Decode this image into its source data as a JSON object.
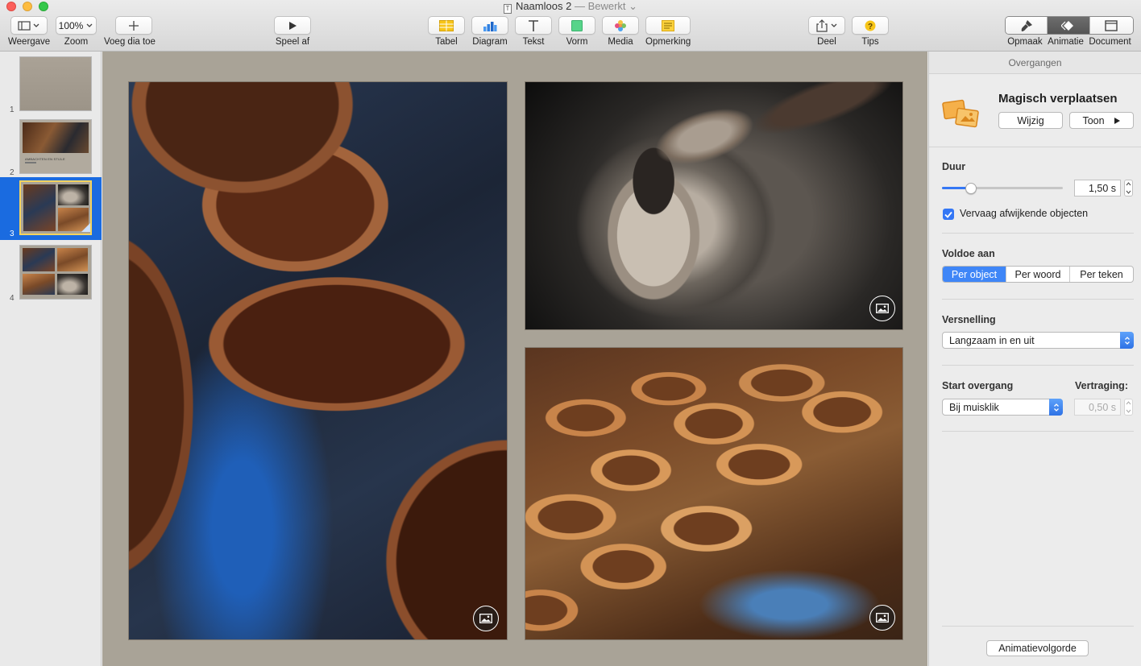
{
  "window": {
    "title": "Naamloos 2",
    "separator": "—",
    "status": "Bewerkt"
  },
  "toolbar": {
    "view_label": "Weergave",
    "zoom_value": "100%",
    "zoom_label": "Zoom",
    "add_slide_label": "Voeg dia toe",
    "play_label": "Speel af",
    "table_label": "Tabel",
    "chart_label": "Diagram",
    "text_label": "Tekst",
    "shape_label": "Vorm",
    "media_label": "Media",
    "comment_label": "Opmerking",
    "share_label": "Deel",
    "tips_label": "Tips",
    "format_label": "Opmaak",
    "animate_label": "Animatie",
    "document_label": "Document"
  },
  "navigator": {
    "slides": [
      {
        "number": "1"
      },
      {
        "number": "2",
        "caption": "AMBACHTEN EN STIJLE"
      },
      {
        "number": "3"
      },
      {
        "number": "4"
      }
    ],
    "selected": "3"
  },
  "inspector": {
    "header": "Overgangen",
    "effect_name": "Magisch verplaatsen",
    "change_button": "Wijzig",
    "preview_button": "Toon",
    "duration_label": "Duur",
    "duration_value": "1,50 s",
    "duration_fraction": 0.24,
    "fade_checkbox_label": "Vervaag afwijkende objecten",
    "fade_checked": true,
    "match_label": "Voldoe aan",
    "match_options": [
      "Per object",
      "Per woord",
      "Per teken"
    ],
    "match_selected": "Per object",
    "acceleration_label": "Versnelling",
    "acceleration_value": "Langzaam in en uit",
    "start_label": "Start overgang",
    "start_value": "Bij muisklik",
    "delay_label": "Vertraging:",
    "delay_value": "0,50 s",
    "order_button": "Animatievolgorde"
  },
  "colors": {
    "accent": "#3477f5",
    "selection": "#1a6be0",
    "canvas": "#a9a397"
  }
}
